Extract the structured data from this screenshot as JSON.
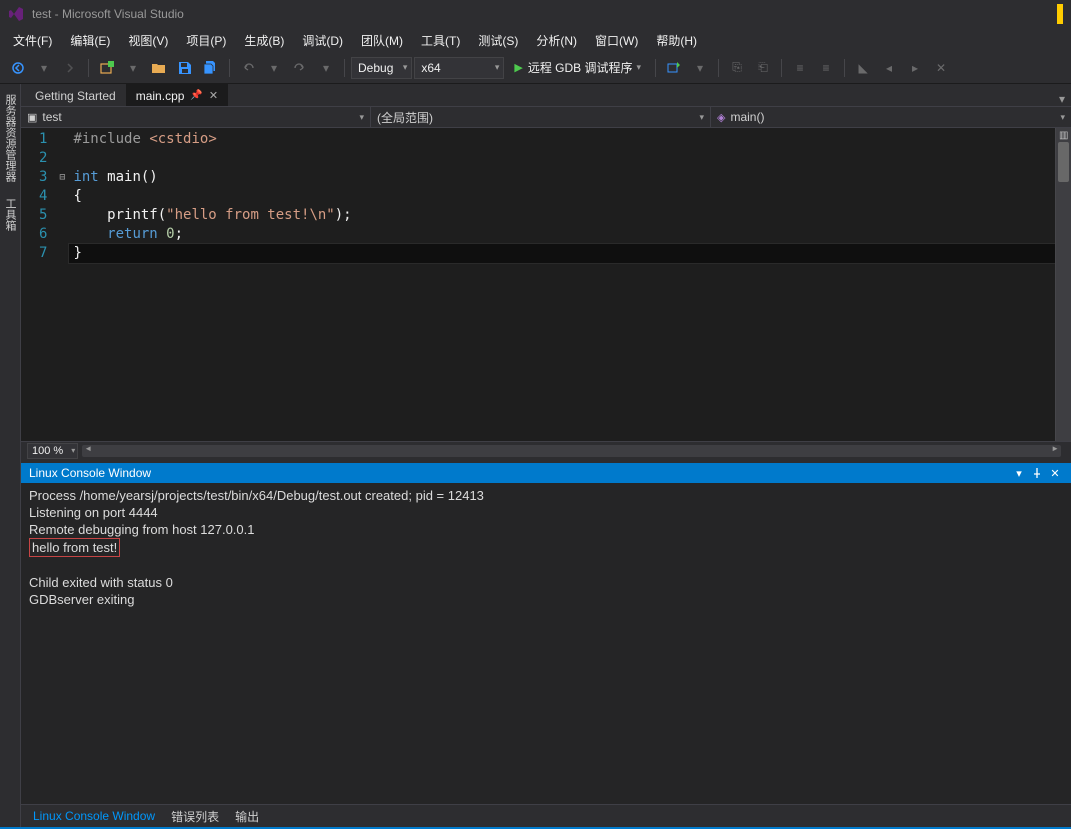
{
  "title": "test - Microsoft Visual Studio",
  "menu": [
    "文件(F)",
    "编辑(E)",
    "视图(V)",
    "项目(P)",
    "生成(B)",
    "调试(D)",
    "团队(M)",
    "工具(T)",
    "测试(S)",
    "分析(N)",
    "窗口(W)",
    "帮助(H)"
  ],
  "toolbar": {
    "config": "Debug",
    "platform": "x64",
    "run_label": "远程 GDB 调试程序"
  },
  "side_tabs": [
    "服务器资源管理器",
    "工具箱"
  ],
  "doc_tabs": [
    {
      "label": "Getting Started",
      "active": false
    },
    {
      "label": "main.cpp",
      "active": true,
      "pinned": true
    }
  ],
  "nav": {
    "scope": "test",
    "range": "(全局范围)",
    "member": "main()"
  },
  "code": {
    "lines": [
      {
        "n": 1,
        "html": "<span class='k-gray'>#include</span> <span class='k-str'>&lt;cstdio&gt;</span>"
      },
      {
        "n": 2,
        "html": ""
      },
      {
        "n": 3,
        "html": "<span class='k-blue'>int</span> main()",
        "fold": "⊟"
      },
      {
        "n": 4,
        "html": "{"
      },
      {
        "n": 5,
        "html": "    printf(<span class='k-str'>\"hello from test!\\n\"</span>);"
      },
      {
        "n": 6,
        "html": "    <span class='k-blue'>return</span> <span class='k-num'>0</span>;"
      },
      {
        "n": 7,
        "html": "}",
        "cursor": true
      }
    ]
  },
  "zoom": "100 %",
  "panel": {
    "title": "Linux Console Window",
    "lines": [
      "Process /home/yearsj/projects/test/bin/x64/Debug/test.out created; pid = 12413",
      "Listening on port 4444",
      "Remote debugging from host 127.0.0.1",
      {
        "boxed": true,
        "text": "hello from test!"
      },
      "",
      "Child exited with status 0",
      "GDBserver exiting"
    ]
  },
  "bottom_tabs": [
    {
      "label": "Linux Console Window",
      "active": true
    },
    {
      "label": "错误列表",
      "active": false
    },
    {
      "label": "输出",
      "active": false
    }
  ]
}
